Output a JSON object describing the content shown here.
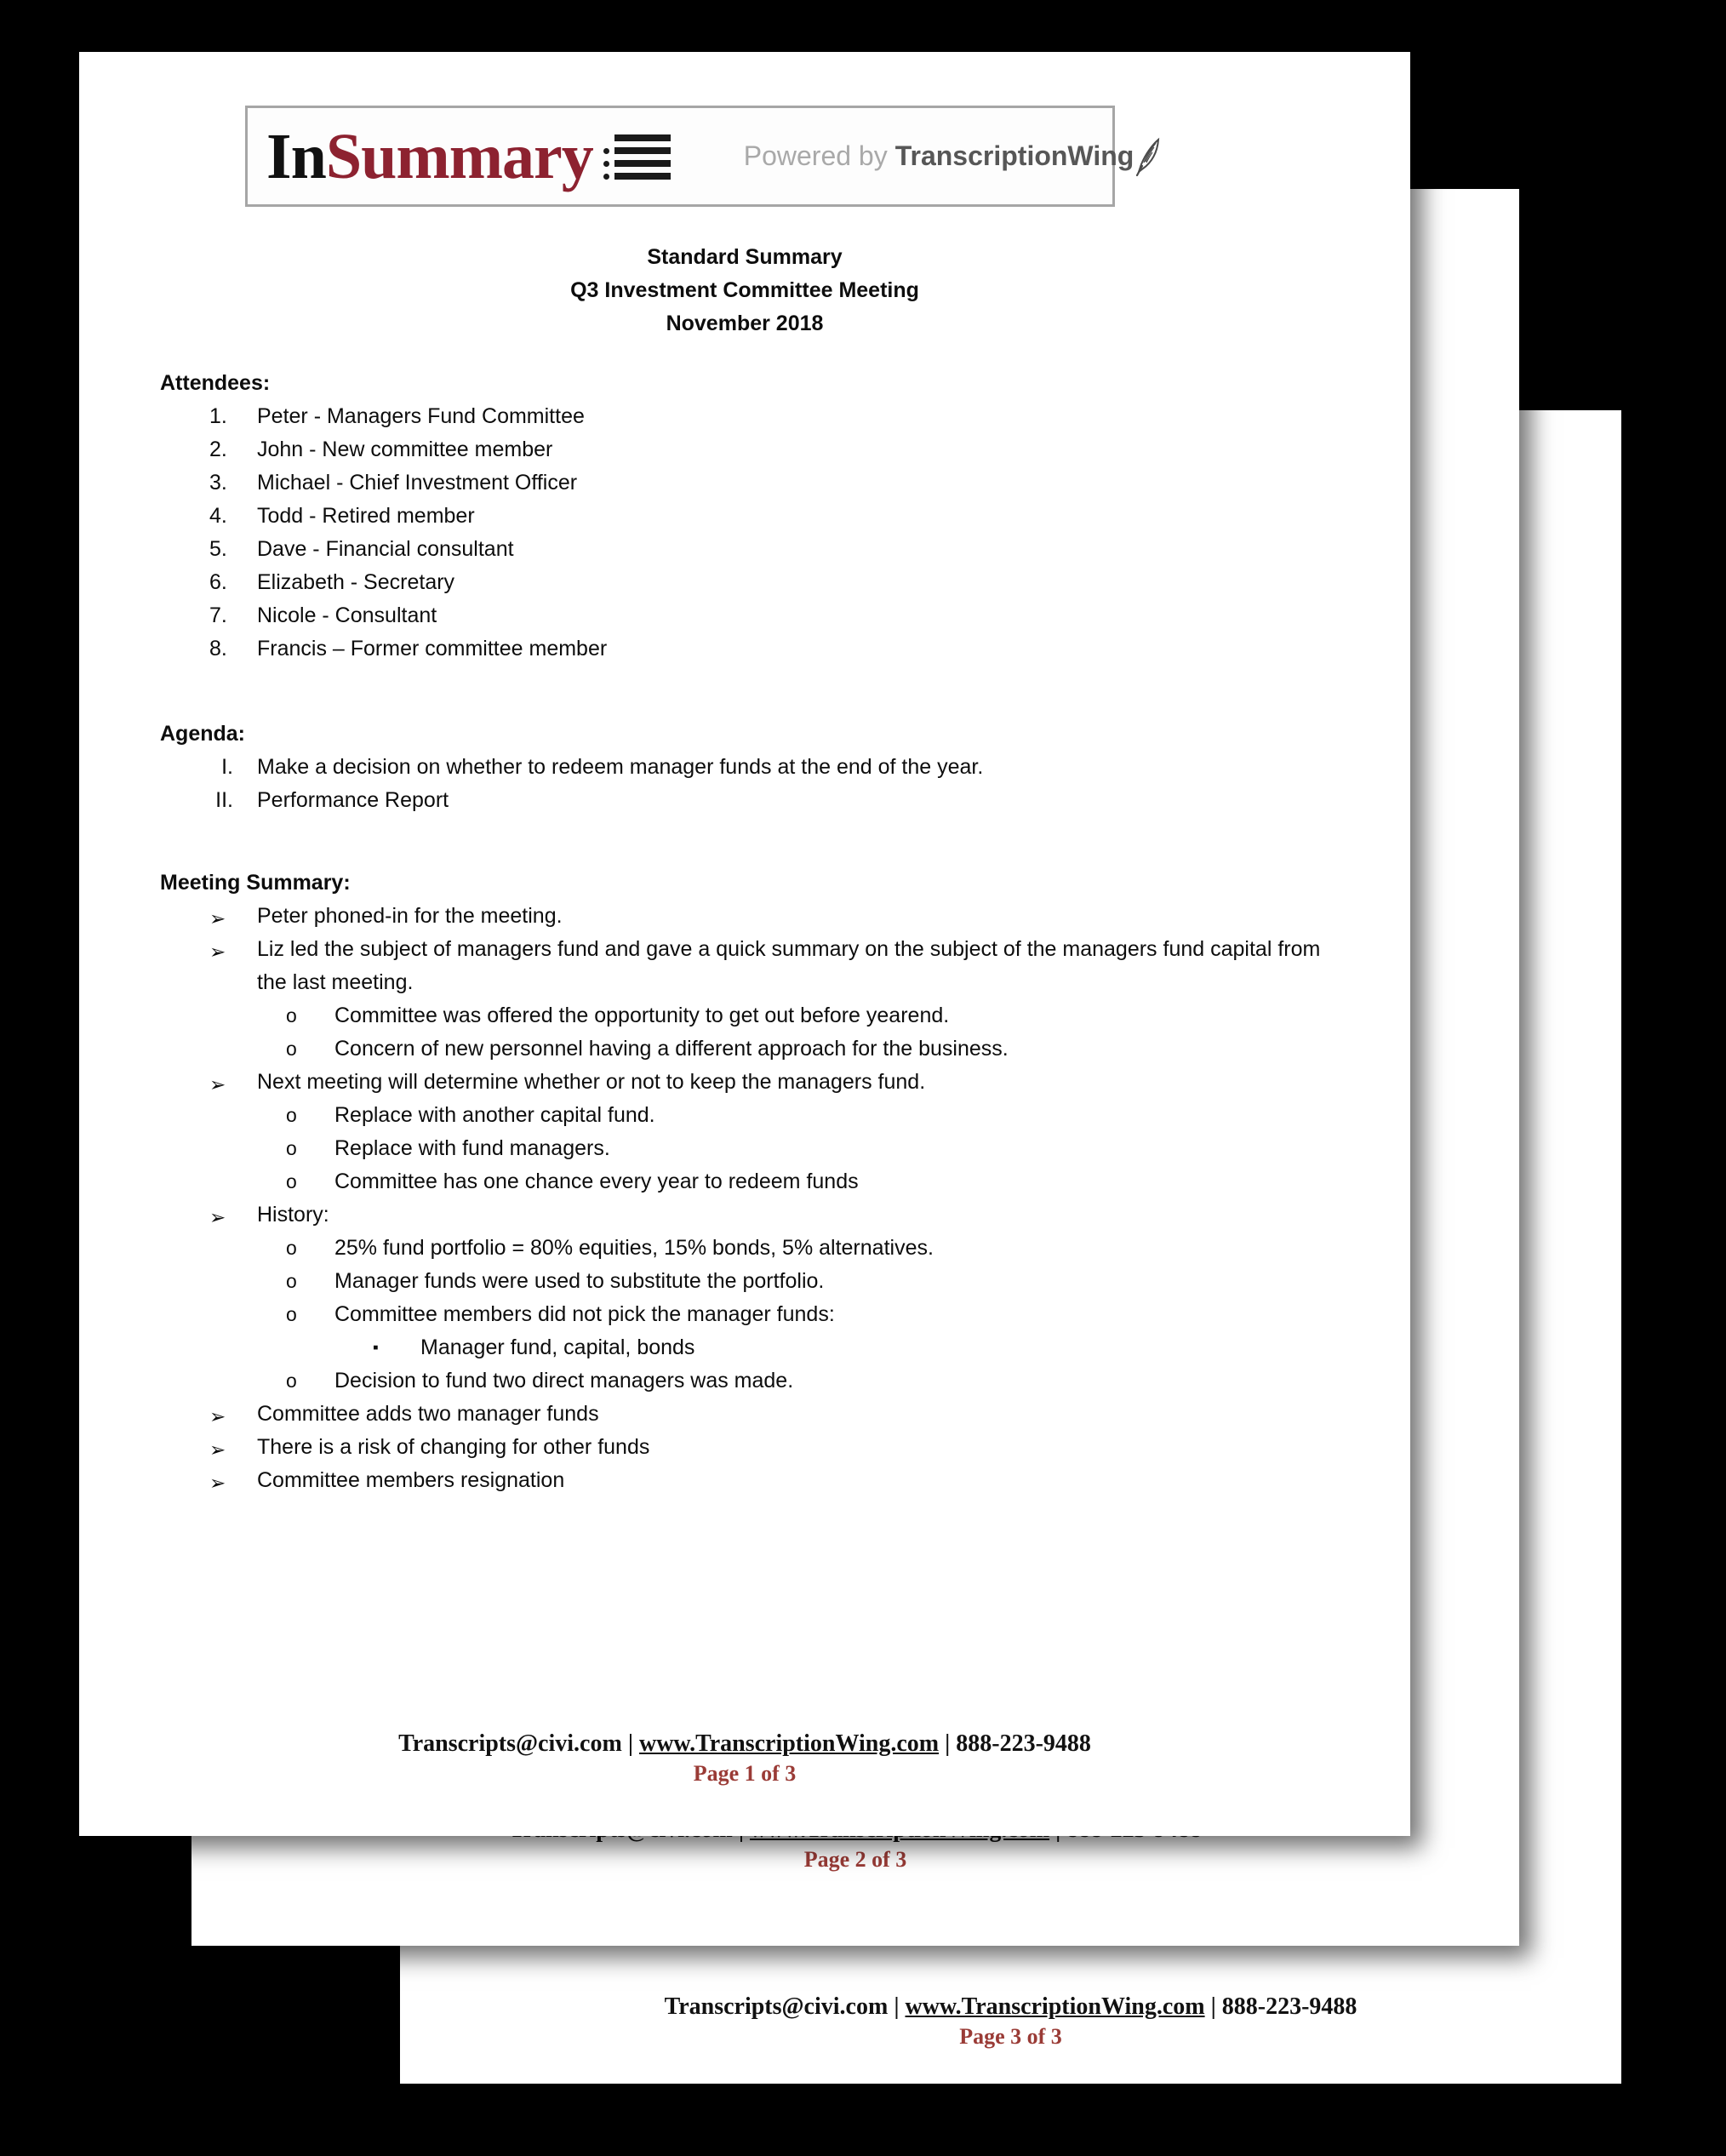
{
  "logo": {
    "word_part_1": "In",
    "word_part_2": "Summary",
    "powered_prefix": "Powered by",
    "powered_brand": "TranscriptionWing",
    "brand_color": "#8d2230"
  },
  "title": {
    "line1": "Standard Summary",
    "line2": "Q3 Investment Committee Meeting",
    "line3": "November 2018"
  },
  "attendees": {
    "heading": "Attendees:",
    "items": [
      {
        "marker": "1.",
        "text": "Peter - Managers Fund Committee"
      },
      {
        "marker": "2.",
        "text": "John - New committee member"
      },
      {
        "marker": "3.",
        "text": "Michael -  Chief Investment Officer"
      },
      {
        "marker": "4.",
        "text": "Todd - Retired member"
      },
      {
        "marker": "5.",
        "text": "Dave - Financial consultant"
      },
      {
        "marker": "6.",
        "text": "Elizabeth - Secretary"
      },
      {
        "marker": "7.",
        "text": "Nicole - Consultant"
      },
      {
        "marker": "8.",
        "text": "Francis – Former committee member"
      }
    ]
  },
  "agenda": {
    "heading": "Agenda:",
    "items": [
      {
        "marker": "I.",
        "text": "Make a decision on whether to redeem manager funds at the end of the year."
      },
      {
        "marker": "II.",
        "text": "Performance Report"
      }
    ]
  },
  "summary": {
    "heading": "Meeting Summary:",
    "bullet_level1": "➢",
    "bullet_level2": "o",
    "bullet_level3": "▪",
    "items": [
      {
        "level": 1,
        "text": "Peter phoned-in for the meeting."
      },
      {
        "level": 1,
        "text": "Liz led the subject of managers fund and gave a quick summary on the subject of the managers fund capital from the last meeting."
      },
      {
        "level": 2,
        "text": "Committee was offered the opportunity to get out before yearend."
      },
      {
        "level": 2,
        "text": "Concern of new personnel having a different approach for the business."
      },
      {
        "level": 1,
        "text": "Next meeting will determine whether or not to keep the managers fund."
      },
      {
        "level": 2,
        "text": "Replace with another capital fund."
      },
      {
        "level": 2,
        "text": "Replace with fund managers."
      },
      {
        "level": 2,
        "text": "Committee has one chance every year to redeem funds"
      },
      {
        "level": 1,
        "text": "History:"
      },
      {
        "level": 2,
        "text": "25% fund portfolio = 80% equities, 15% bonds, 5% alternatives."
      },
      {
        "level": 2,
        "text": "Manager funds were used to substitute the portfolio."
      },
      {
        "level": 2,
        "text": "Committee members did not pick the manager funds:"
      },
      {
        "level": 3,
        "text": "Manager fund, capital, bonds"
      },
      {
        "level": 2,
        "text": "Decision to fund two direct managers was made."
      },
      {
        "level": 1,
        "text": "Committee adds two manager funds"
      },
      {
        "level": 1,
        "text": "There is a risk of changing for other funds"
      },
      {
        "level": 1,
        "text": "Committee members resignation"
      }
    ]
  },
  "footer": {
    "email": "Transcripts@civi.com",
    "separator": " | ",
    "url": "www.TranscriptionWing.com",
    "phone": "888-223-9488",
    "page_1_label": "Page 1 of 3",
    "page_2_label": "Page 2 of 3",
    "page_3_label": "Page 3 of 3",
    "page_number_color": "#9a3b36"
  }
}
